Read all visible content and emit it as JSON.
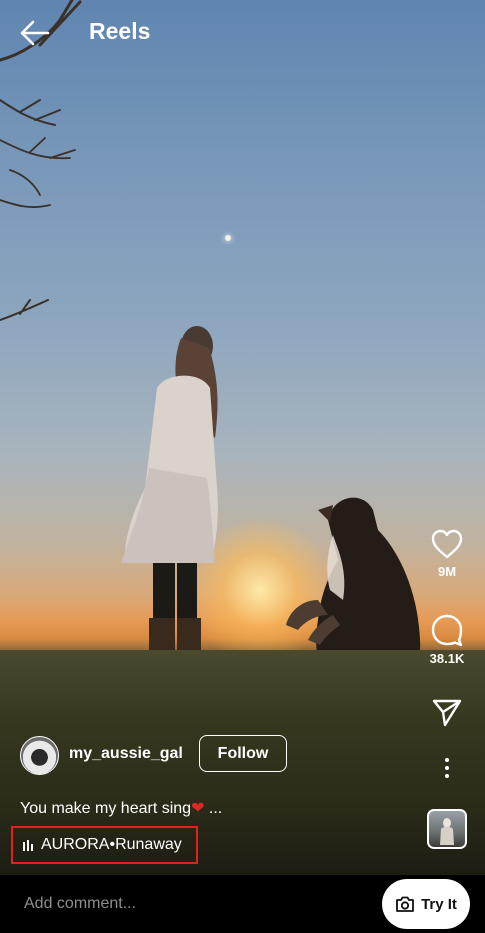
{
  "header": {
    "title": "Reels",
    "back_icon": "arrow-left-icon"
  },
  "actions": {
    "like": {
      "icon": "heart-outline-icon",
      "count": "9M"
    },
    "comment": {
      "icon": "comment-bubble-icon",
      "count": "38.1K"
    },
    "share": {
      "icon": "paper-plane-icon"
    },
    "more": {
      "icon": "more-vertical-icon"
    }
  },
  "author": {
    "username": "my_aussie_gal",
    "follow_label": "Follow"
  },
  "caption": {
    "text": "You make my heart sing",
    "emoji": "❤",
    "more": " ..."
  },
  "audio": {
    "artist": "AURORA",
    "separator": " • ",
    "track": "Runaway",
    "highlight_color": "#e32019"
  },
  "comment_bar": {
    "placeholder": "Add comment...",
    "try_label": "Try It",
    "try_icon": "camera-icon"
  }
}
